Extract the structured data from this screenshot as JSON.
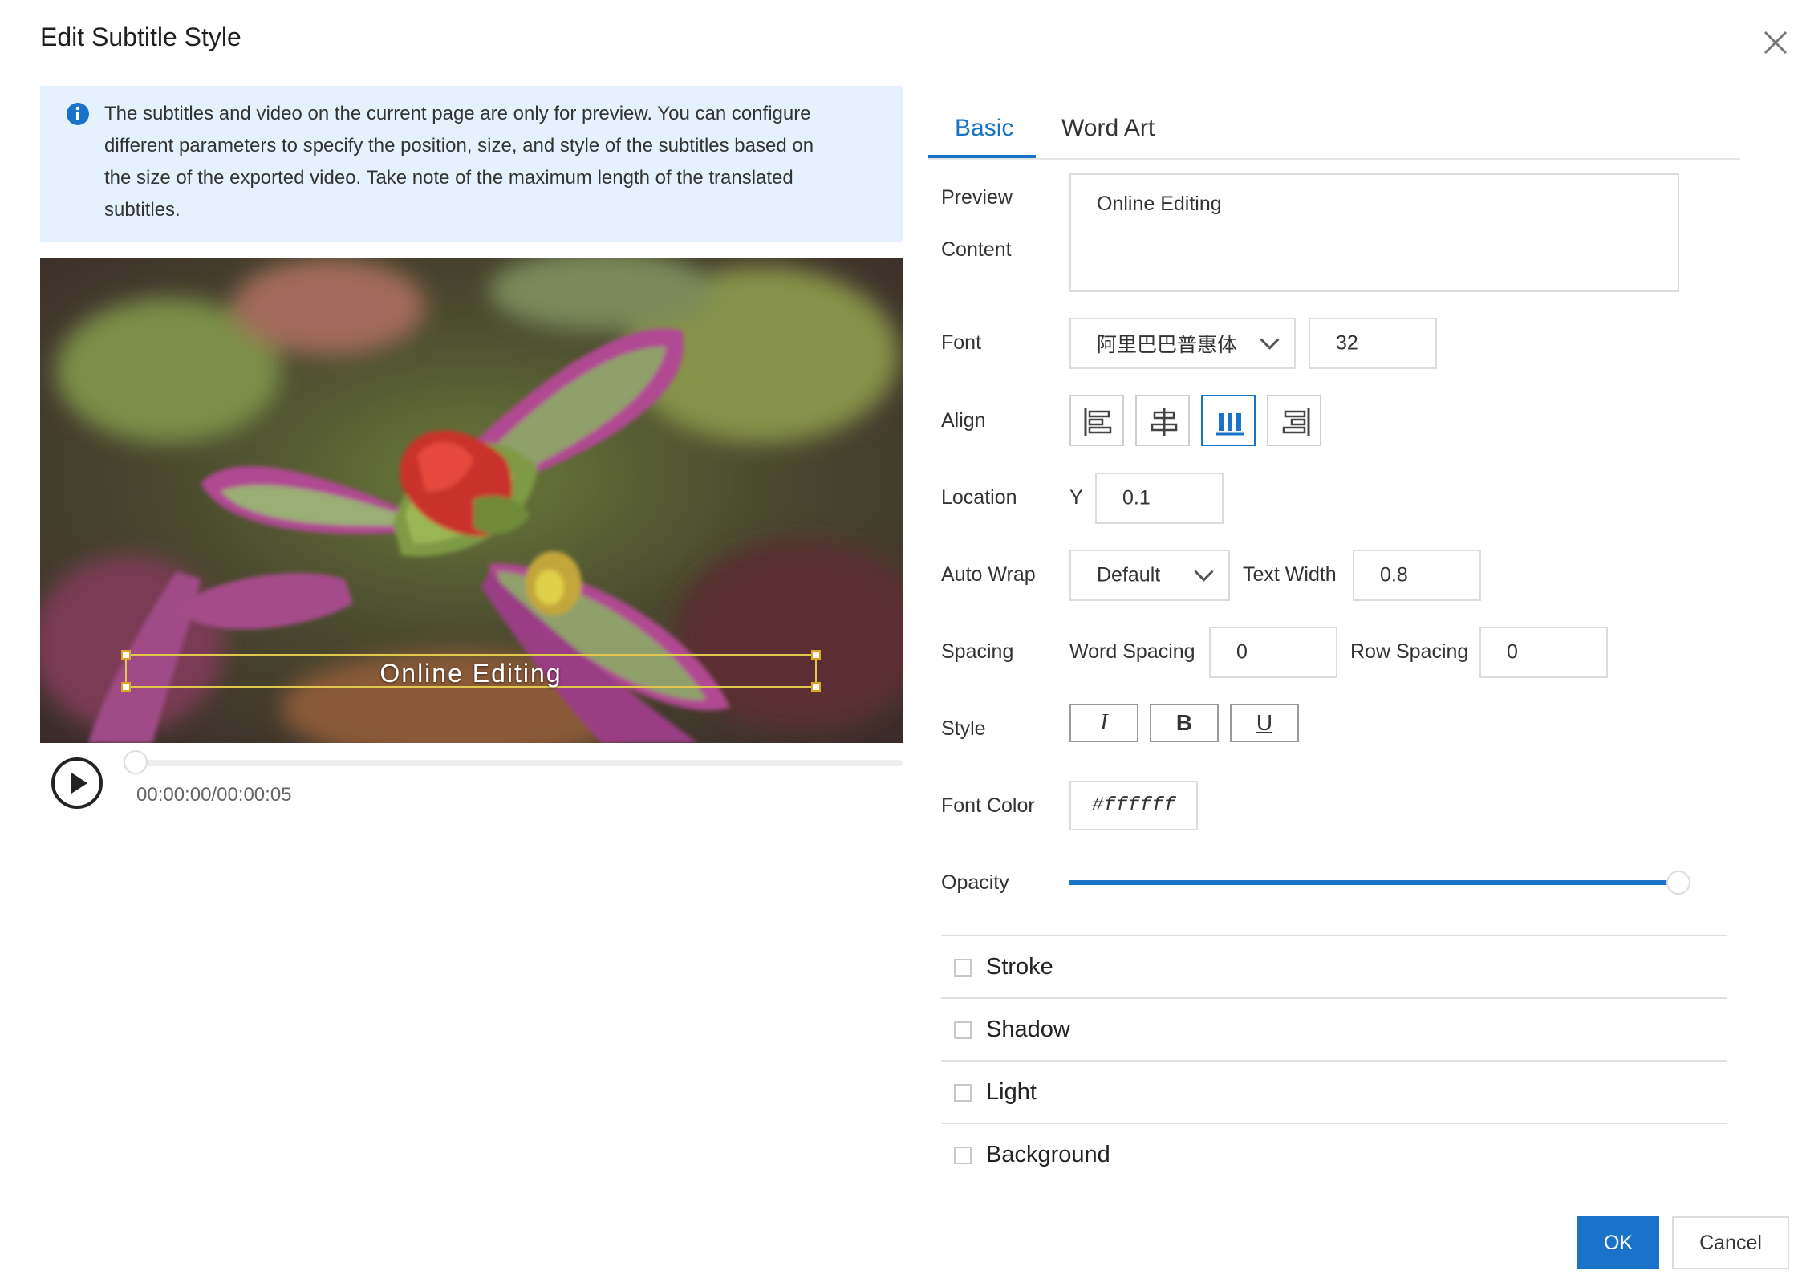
{
  "dialog": {
    "title": "Edit Subtitle Style"
  },
  "info": {
    "text": "The subtitles and video on the current page are only for preview. You can configure different parameters to specify the position, size, and style of the subtitles based on the size of the exported video. Take note of the maximum length of the translated subtitles."
  },
  "video": {
    "subtitle": "Online Editing",
    "timecode": "00:00:00/00:00:05",
    "progress": 0
  },
  "tabs": [
    {
      "label": "Basic",
      "active": true
    },
    {
      "label": "Word Art",
      "active": false
    }
  ],
  "form": {
    "preview_label_1": "Preview",
    "preview_label_2": "Content",
    "preview_value": "Online Editing",
    "font_label": "Font",
    "font_value": "阿里巴巴普惠体",
    "font_size": "32",
    "align_label": "Align",
    "align_options": [
      "left",
      "center",
      "justify",
      "right"
    ],
    "align_selected": "justify",
    "location_label": "Location",
    "location_y_label": "Y",
    "location_y": "0.1",
    "autowrap_label": "Auto Wrap",
    "autowrap_value": "Default",
    "text_width_label": "Text Width",
    "text_width": "0.8",
    "spacing_label": "Spacing",
    "word_spacing_label": "Word Spacing",
    "word_spacing": "0",
    "row_spacing_label": "Row Spacing",
    "row_spacing": "0",
    "style_label": "Style",
    "style_italic": "I",
    "style_bold": "B",
    "style_underline": "U",
    "font_color_label": "Font Color",
    "font_color": "#ffffff",
    "opacity_label": "Opacity",
    "opacity": 1.0
  },
  "sections": [
    "Stroke",
    "Shadow",
    "Light",
    "Background"
  ],
  "footer": {
    "ok": "OK",
    "cancel": "Cancel"
  },
  "colors": {
    "accent": "#1a73c9",
    "info_bg": "#e5f2fd"
  }
}
